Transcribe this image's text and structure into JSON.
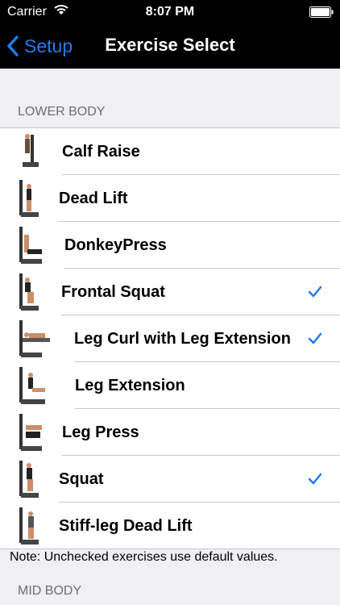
{
  "status_bar": {
    "carrier": "Carrier",
    "time": "8:07 PM"
  },
  "nav": {
    "back_label": "Setup",
    "title": "Exercise Select"
  },
  "sections": {
    "lower_body": "LOWER BODY",
    "mid_body": "MID BODY"
  },
  "exercises": [
    {
      "label": "Calf Raise",
      "checked": false
    },
    {
      "label": "Dead Lift",
      "checked": false
    },
    {
      "label": "DonkeyPress",
      "checked": false
    },
    {
      "label": "Frontal Squat",
      "checked": true
    },
    {
      "label": "Leg Curl with Leg Extension",
      "checked": true
    },
    {
      "label": "Leg Extension",
      "checked": false
    },
    {
      "label": "Leg Press",
      "checked": false
    },
    {
      "label": "Squat",
      "checked": true
    },
    {
      "label": "Stiff-leg Dead Lift",
      "checked": false
    }
  ],
  "note": "Note: Unchecked exercises use default values.",
  "colors": {
    "accent": "#1f7cf2",
    "nav_background": "#000000",
    "group_background": "#efeff4"
  },
  "icons": {
    "back": "chevron-left-icon",
    "check": "checkmark-icon",
    "wifi": "wifi-icon",
    "battery": "battery-icon",
    "thumbnail": "exercise-machine-thumbnail"
  }
}
